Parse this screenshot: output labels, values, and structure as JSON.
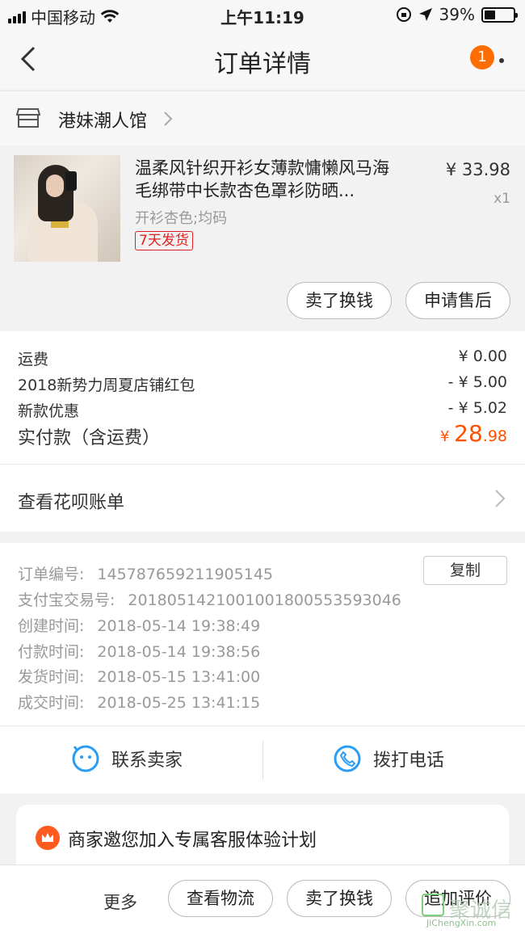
{
  "status_bar": {
    "carrier": "中国移动",
    "time": "上午11:19",
    "battery": "39%",
    "battery_level": 0.39
  },
  "nav": {
    "title": "订单详情",
    "badge_count": "1"
  },
  "shop": {
    "name": "港妹潮人馆"
  },
  "product": {
    "title": "温柔风针织开衫女薄款慵懒风马海毛绑带中长款杏色罩衫防晒...",
    "spec": "开衫杏色;均码",
    "tag": "7天发货",
    "price": "¥ 33.98",
    "qty": "x1",
    "btn_sell": "卖了换钱",
    "btn_aftersale": "申请售后"
  },
  "fees": {
    "shipping_label": "运费",
    "shipping_value": "¥ 0.00",
    "redpacket_label": "2018新势力周夏店铺红包",
    "redpacket_value": "- ¥ 5.00",
    "discount_label": "新款优惠",
    "discount_value": "- ¥ 5.02",
    "total_label": "实付款（含运费）",
    "total_currency": "¥ ",
    "total_int": "28",
    "total_dec": ".98"
  },
  "huabei": {
    "label": "查看花呗账单"
  },
  "order_info": {
    "order_no_label": "订单编号:",
    "order_no": "145787659211905145",
    "copy_label": "复制",
    "alipay_label": "支付宝交易号:",
    "alipay_no": "2018051421001001800553593046",
    "created_label": "创建时间:",
    "created": "2018-05-14 19:38:49",
    "paid_label": "付款时间:",
    "paid": "2018-05-14 19:38:56",
    "shipped_label": "发货时间:",
    "shipped": "2018-05-15 13:41:00",
    "done_label": "成交时间:",
    "done": "2018-05-25 13:41:15"
  },
  "contact": {
    "seller": "联系卖家",
    "phone": "拨打电话"
  },
  "promo": {
    "text": "商家邀您加入专属客服体验计划"
  },
  "bottom_bar": {
    "more": "更多",
    "logistics": "查看物流",
    "sell": "卖了换钱",
    "review": "追加评价"
  },
  "watermark": {
    "text": "聚诚信",
    "url": "JiChengXin.com"
  },
  "colors": {
    "accent": "#ff5000",
    "badge": "#ff6d00",
    "icon_blue": "#2a9df4"
  }
}
